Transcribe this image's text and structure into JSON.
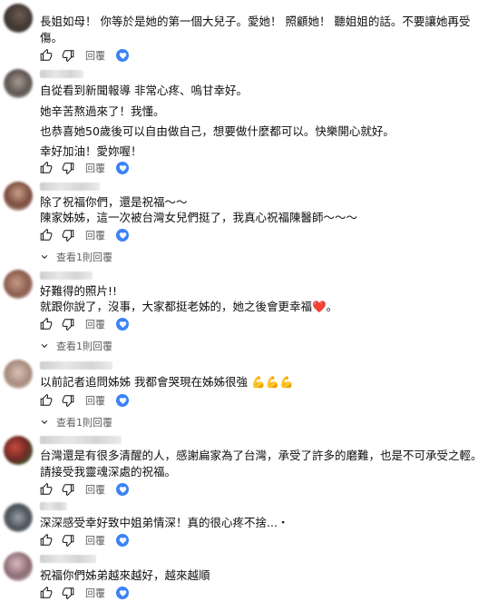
{
  "comments": [
    {
      "lines": [
        "長姐如母！ 你等於是她的第一個大兒子。愛她！ 照顧她！ 聽姐姐的話。不要讓她再受",
        "傷。"
      ],
      "reply_label": "回覆"
    },
    {
      "paragraphs": [
        "自從看到新聞報導 非常心疼、嗚甘幸好。",
        "她辛苦熬過來了！我懂。",
        "也恭喜她50歲後可以自由做自己，想要做什麼都可以。快樂開心就好。",
        "幸好加油！愛妳喔！"
      ],
      "reply_label": "回覆"
    },
    {
      "lines": [
        "除了祝福你們，還是祝福～～",
        "陳家姊姊，這一次被台灣女兒們挺了，我真心祝福陳醫師～～～"
      ],
      "reply_label": "回覆",
      "view_replies": "查看1則回覆"
    },
    {
      "lines": [
        "好難得的照片!!",
        "就跟你說了，沒事，大家都挺老姊的，她之後會更幸福"
      ],
      "heart": "❤️",
      "end": "。",
      "reply_label": "回覆",
      "view_replies": "查看1則回覆"
    },
    {
      "lines": [
        "以前記者追問姊姊 我都會哭現在姊姊很強"
      ],
      "emoji": "💪💪💪",
      "reply_label": "回覆",
      "view_replies": "查看1則回覆"
    },
    {
      "lines": [
        "台灣還是有很多清醒的人，感謝扁家為了台灣，承受了許多的磨難，也是不可承受之輕。",
        "請接受我靈魂深處的祝福。"
      ],
      "reply_label": "回覆"
    },
    {
      "lines": [
        "深深感受幸好致中姐弟情深！真的很心疼不捨...・"
      ],
      "reply_label": "回覆"
    },
    {
      "lines": [
        "祝福你們姊弟越來越好，越來越順"
      ],
      "reply_label": "回覆"
    }
  ],
  "colors": {
    "text": "#0f0f0f",
    "secondary": "#606060",
    "creator_heart_bg": "#3b82f6"
  },
  "icons": [
    "thumb-up-icon",
    "thumb-down-icon",
    "creator-heart-icon",
    "chevron-down-icon"
  ]
}
